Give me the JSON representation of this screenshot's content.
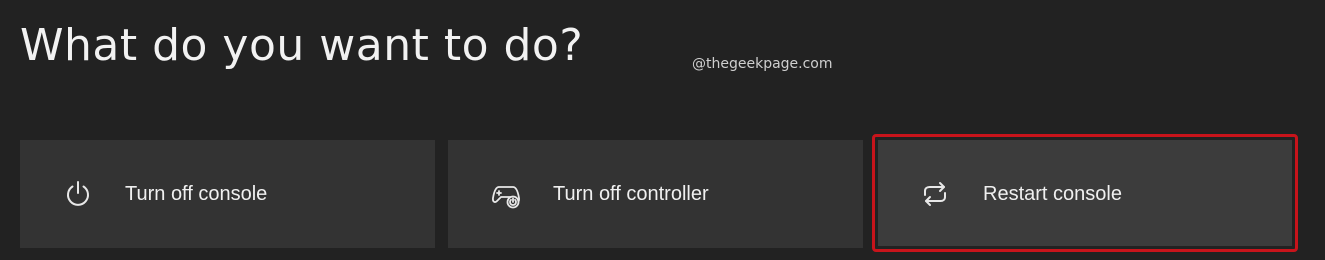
{
  "heading": "What do you want to do?",
  "watermark": "@thegeekpage.com",
  "options": [
    {
      "label": "Turn off console",
      "icon": "power-icon"
    },
    {
      "label": "Turn off controller",
      "icon": "controller-power-icon"
    },
    {
      "label": "Restart console",
      "icon": "restart-icon"
    }
  ],
  "highlight_color": "#c8141b",
  "selected_option": "Restart console"
}
